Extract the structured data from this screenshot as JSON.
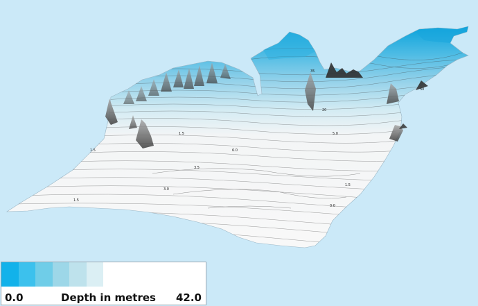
{
  "legend": {
    "min_label": "0.0",
    "title": "Depth in metres",
    "max_label": "42.0",
    "color_classes": [
      "#12b2ea",
      "#3cc1ed",
      "#6fcde8",
      "#9dd7e8",
      "#bee2ec",
      "#dbeff4",
      "#ffffff",
      "#ffffff",
      "#ffffff",
      "#ffffff",
      "#ffffff",
      "#ffffff"
    ]
  },
  "colors": {
    "background": "#cbe9f8",
    "deep_water": "#2fb0e0",
    "shallow_surface": "#f4f4f4",
    "contour_lines": "#3a3a3a"
  }
}
